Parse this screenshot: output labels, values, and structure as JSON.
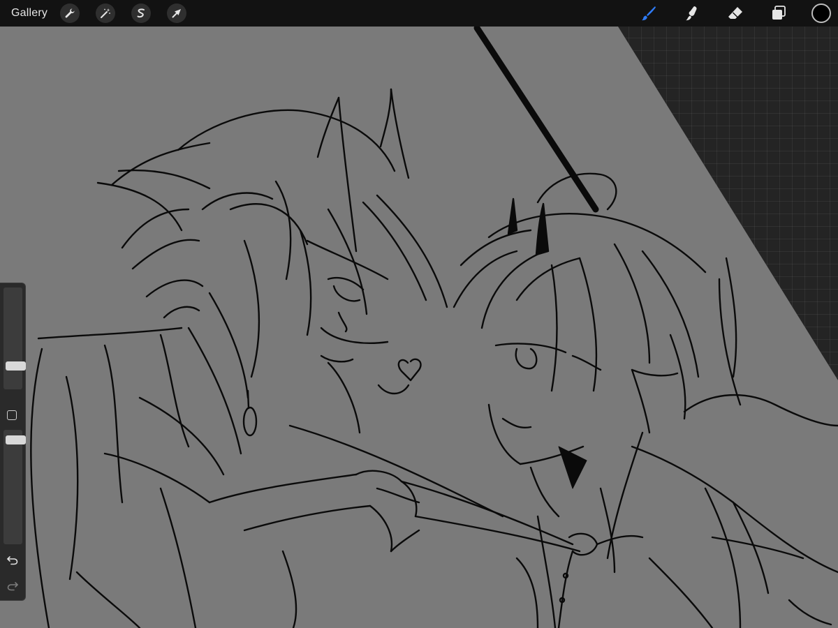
{
  "app": {
    "gallery_label": "Gallery",
    "accent_color": "#2f7bf5",
    "current_color": "#000000"
  },
  "toolbar": {
    "left_tools": [
      {
        "name": "wrench-icon",
        "tool": "actions"
      },
      {
        "name": "magic-wand-icon",
        "tool": "adjustments"
      },
      {
        "name": "selection-s-icon",
        "tool": "selection"
      },
      {
        "name": "arrow-cursor-icon",
        "tool": "transform"
      }
    ],
    "right_tools": [
      {
        "name": "brush-icon",
        "tool": "paint",
        "active": true
      },
      {
        "name": "smudge-icon",
        "tool": "smudge",
        "active": false
      },
      {
        "name": "eraser-icon",
        "tool": "erase",
        "active": false
      },
      {
        "name": "layers-icon",
        "tool": "layers",
        "active": false
      }
    ]
  },
  "sidebar": {
    "brush_size": 0.2,
    "brush_opacity": 0.95,
    "icons": [
      "square-modify-icon",
      "undo-icon",
      "redo-icon"
    ]
  }
}
